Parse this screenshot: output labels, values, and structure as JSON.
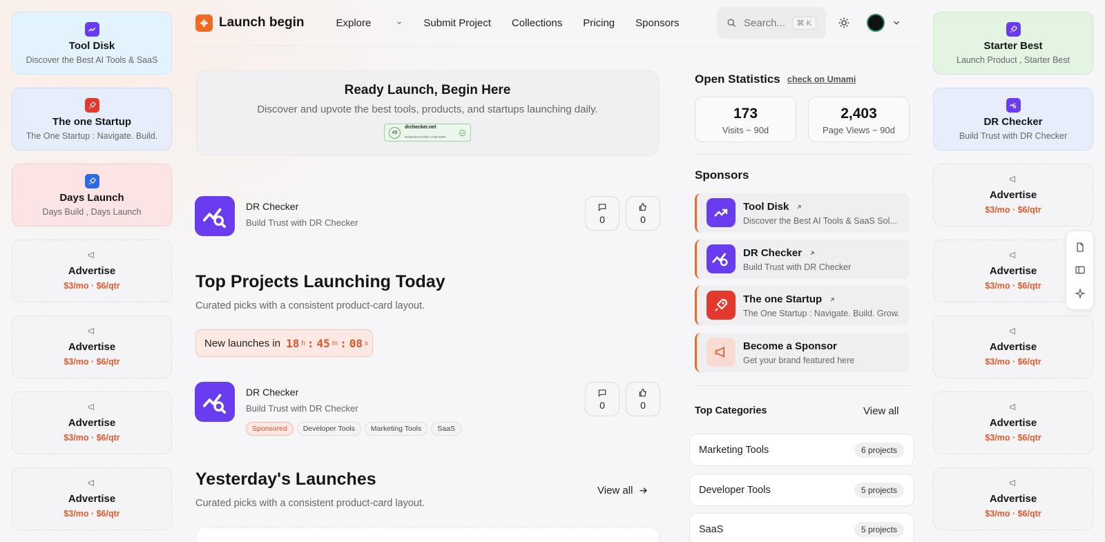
{
  "left_rail": [
    {
      "title": "Tool Disk",
      "subtitle": "Discover the Best AI Tools & SaaS",
      "style": "blue",
      "icon": "chart-up-icon",
      "icon_color": "#6a3cf0"
    },
    {
      "title": "The one Startup",
      "subtitle": "The One Startup : Navigate. Build.",
      "style": "lblue",
      "icon": "rocket-icon",
      "icon_color": "#e2382e"
    },
    {
      "title": "Days Launch",
      "subtitle": "Days Build , Days Launch",
      "style": "red",
      "icon": "rocket-icon",
      "icon_color": "#2e6ae2"
    },
    {
      "title": "Advertise",
      "price": "$3/mo · $6/qtr",
      "style": "dashed"
    },
    {
      "title": "Advertise",
      "price": "$3/mo · $6/qtr",
      "style": "dashed"
    },
    {
      "title": "Advertise",
      "price": "$3/mo · $6/qtr",
      "style": "dashed"
    },
    {
      "title": "Advertise",
      "price": "$3/mo · $6/qtr",
      "style": "dashed"
    }
  ],
  "right_rail": [
    {
      "title": "Starter Best",
      "subtitle": "Launch Product , Starter Best",
      "style": "green",
      "icon": "rocket-icon",
      "icon_color": "#6a3cf0"
    },
    {
      "title": "DR Checker",
      "subtitle": "Build Trust with DR Checker",
      "style": "lblue",
      "icon": "magnify-chart-icon",
      "icon_color": "#6a3cf0"
    },
    {
      "title": "Advertise",
      "price": "$3/mo · $6/qtr",
      "style": "dashed"
    },
    {
      "title": "Advertise",
      "price": "$3/mo · $6/qtr",
      "style": "dashed"
    },
    {
      "title": "Advertise",
      "price": "$3/mo · $6/qtr",
      "style": "dashed"
    },
    {
      "title": "Advertise",
      "price": "$3/mo · $6/qtr",
      "style": "dashed"
    },
    {
      "title": "Advertise",
      "price": "$3/mo · $6/qtr",
      "style": "dashed"
    }
  ],
  "header": {
    "brand": "Launch begin",
    "nav": [
      "Explore",
      "Submit Project",
      "Collections",
      "Pricing",
      "Sponsors"
    ],
    "search_placeholder": "Search...",
    "search_shortcut": "⌘ K"
  },
  "hero": {
    "title": "Ready Launch, Begin Here",
    "subtitle": "Discover and upvote the best tools, products, and startups launching daily.",
    "badge_score": "49",
    "badge_site": "drchecker.net",
    "badge_caption": "DOMAIN RATING CHECKER"
  },
  "featured": {
    "name": "DR Checker",
    "desc": "Build Trust with DR Checker",
    "comments": "0",
    "upvotes": "0"
  },
  "today": {
    "title": "Top Projects Launching Today",
    "subtitle": "Curated picks with a consistent product-card layout.",
    "timer_label": "New launches in",
    "hours": "18",
    "minutes": "45",
    "seconds": "08",
    "h_unit": "h",
    "m_unit": "m",
    "s_unit": "s",
    "product": {
      "name": "DR Checker",
      "desc": "Build Trust with DR Checker",
      "comments": "0",
      "upvotes": "0",
      "tags": [
        "Sponsored",
        "Developer Tools",
        "Marketing Tools",
        "SaaS"
      ]
    }
  },
  "yesterday": {
    "title": "Yesterday's Launches",
    "subtitle": "Curated picks with a consistent product-card layout.",
    "view_all": "View all"
  },
  "stats": {
    "title": "Open Statistics",
    "link": "check on Umami",
    "visits": "173",
    "visits_label": "Visits ~ 90d",
    "views": "2,403",
    "views_label": "Page Views ~ 90d"
  },
  "sponsors": {
    "title": "Sponsors",
    "items": [
      {
        "name": "Tool Disk",
        "desc": "Discover the Best AI Tools & SaaS Sol...",
        "icon": "chart-up-icon",
        "color": "#6a3cf0"
      },
      {
        "name": "DR Checker",
        "desc": "Build Trust with DR Checker",
        "icon": "magnify-chart-icon",
        "color": "#6a3cf0"
      },
      {
        "name": "The one Startup",
        "desc": "The One Startup : Navigate. Build. Grow.",
        "icon": "rocket-icon",
        "color": "#e2382e"
      },
      {
        "name": "Become a Sponsor",
        "desc": "Get your brand featured here",
        "icon": "megaphone-icon",
        "color": "#f8dcd3"
      }
    ]
  },
  "categories": {
    "title": "Top Categories",
    "view_all": "View all",
    "items": [
      {
        "name": "Marketing Tools",
        "count": "6 projects"
      },
      {
        "name": "Developer Tools",
        "count": "5 projects"
      },
      {
        "name": "SaaS",
        "count": "5 projects"
      }
    ]
  },
  "colors": {
    "accent": "#f06a24",
    "price": "#e05a2b",
    "purple": "#6a3cf0"
  }
}
